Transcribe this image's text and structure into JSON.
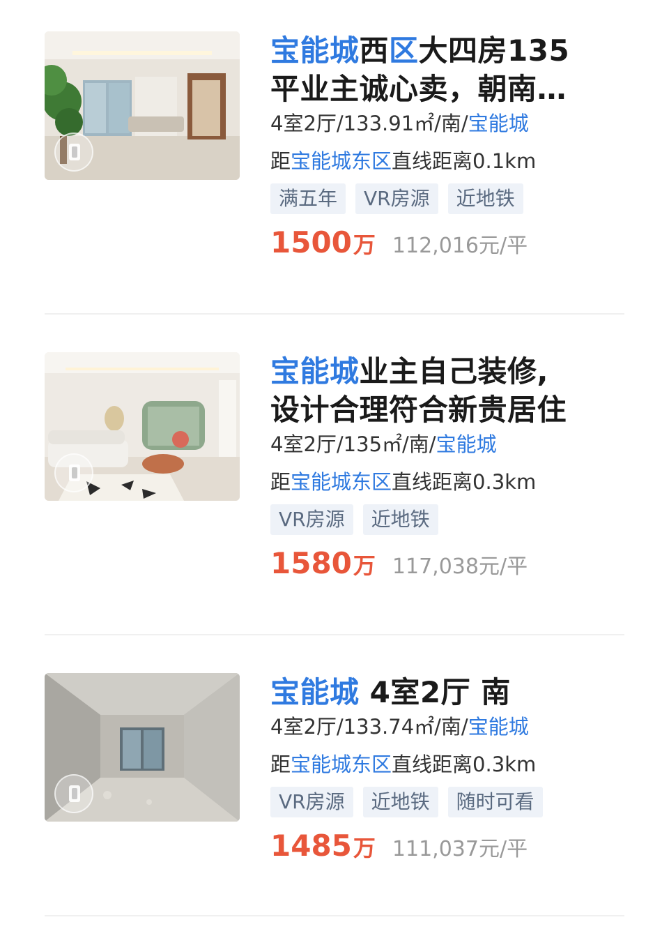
{
  "listings": [
    {
      "title_hl1": "宝能城",
      "title_mid": "西",
      "title_hl2": "区",
      "title_line1_rest": "大四房135",
      "title_line2": "平业主诚心卖，朝南…",
      "spec_text": "4室2厅/133.91㎡/南/",
      "spec_link": "宝能城",
      "dist_prefix": "距",
      "dist_link": "宝能城东区",
      "dist_rest": "直线距离0.1km",
      "tags": [
        "满五年",
        "VR房源",
        "近地铁"
      ],
      "price": "1500",
      "price_unit": "万",
      "unit_price": "112,016元/平"
    },
    {
      "title_hl1": "宝能城",
      "title_line1_rest": "业主自己装修,",
      "title_line2": "设计合理符合新贵居住",
      "spec_text": "4室2厅/135㎡/南/",
      "spec_link": "宝能城",
      "dist_prefix": "距",
      "dist_link": "宝能城东区",
      "dist_rest": "直线距离0.3km",
      "tags": [
        "VR房源",
        "近地铁"
      ],
      "price": "1580",
      "price_unit": "万",
      "unit_price": "117,038元/平"
    },
    {
      "title_hl1": "宝能城",
      "title_line1_rest": " 4室2厅 南",
      "spec_text": "4室2厅/133.74㎡/南/",
      "spec_link": "宝能城",
      "dist_prefix": "距",
      "dist_link": "宝能城东区",
      "dist_rest": "直线距离0.3km",
      "tags": [
        "VR房源",
        "近地铁",
        "随时可看"
      ],
      "price": "1485",
      "price_unit": "万",
      "unit_price": "111,037元/平"
    }
  ],
  "colors": {
    "link_blue": "#2f7ae0",
    "price_red": "#e8563a",
    "tag_bg": "#eef2f8"
  },
  "icons": {
    "vr_badge": "vr-badge-icon"
  }
}
